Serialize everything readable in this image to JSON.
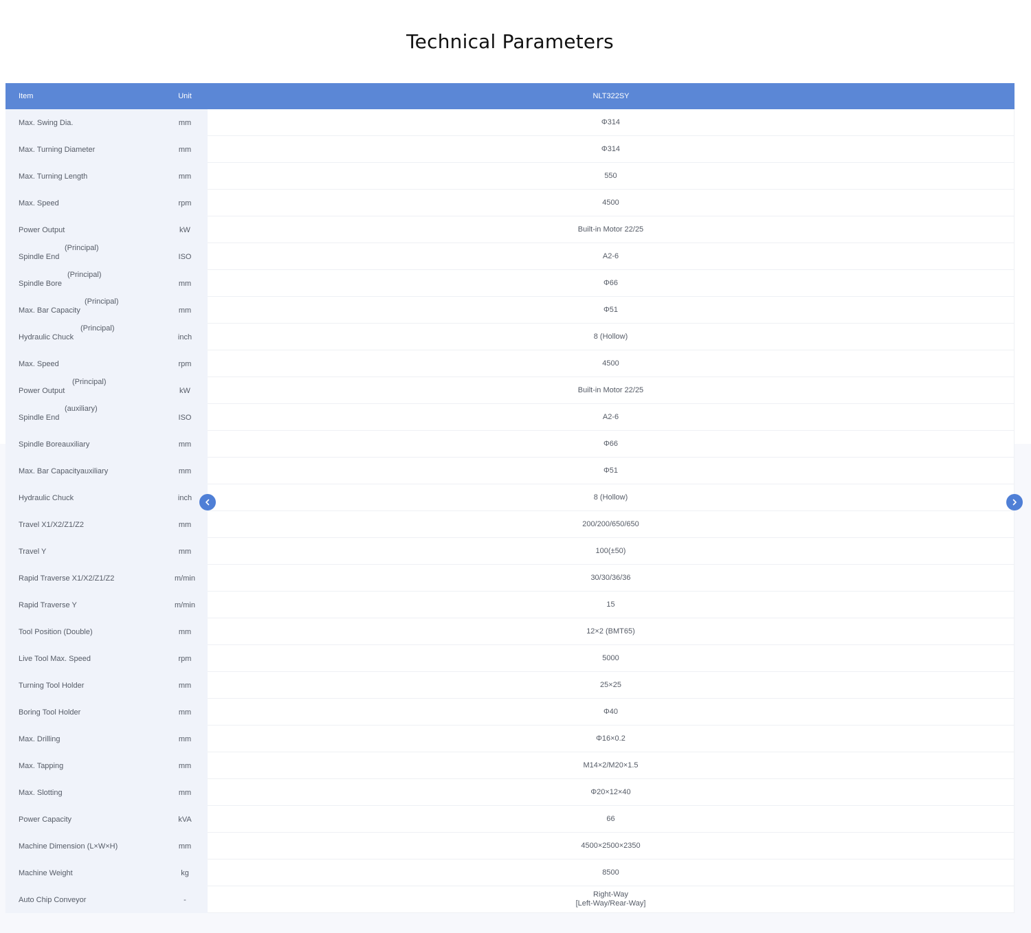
{
  "title": "Technical Parameters",
  "table": {
    "headers": {
      "item": "Item",
      "unit": "Unit",
      "model": "NLT322SY"
    },
    "rows": [
      {
        "item": "Max. Swing Dia.",
        "sub": "",
        "unit": "mm",
        "value": "Φ314"
      },
      {
        "item": "Max. Turning Diameter",
        "sub": "",
        "unit": "mm",
        "value": "Φ314"
      },
      {
        "item": "Max. Turning Length",
        "sub": "",
        "unit": "mm",
        "value": "550"
      },
      {
        "item": "Max. Speed",
        "sub": "",
        "unit": "rpm",
        "value": "4500"
      },
      {
        "item": "Power Output",
        "sub": "",
        "unit": "kW",
        "value": "Built-in   Motor 22/25"
      },
      {
        "item": "Spindle End",
        "sub": "(Principal)",
        "unit": "ISO",
        "value": "A2-6"
      },
      {
        "item": "Spindle Bore",
        "sub": "(Principal)",
        "unit": "mm",
        "value": "Φ66"
      },
      {
        "item": "Max. Bar Capacity",
        "sub": "(Principal)",
        "unit": "mm",
        "value": "Φ51"
      },
      {
        "item": "Hydraulic Chuck",
        "sub": "(Principal)",
        "unit": "inch",
        "value": "8   (Hollow)"
      },
      {
        "item": "Max. Speed",
        "sub": "",
        "unit": "rpm",
        "value": "4500"
      },
      {
        "item": "Power Output",
        "sub": "(Principal)",
        "unit": "kW",
        "value": "Built-in   Motor 22/25"
      },
      {
        "item": "Spindle End",
        "sub": "(auxiliary)",
        "unit": "ISO",
        "value": "A2-6"
      },
      {
        "item": "Spindle Boreauxiliary",
        "sub": "",
        "unit": "mm",
        "value": "Φ66"
      },
      {
        "item": "Max. Bar Capacityauxiliary",
        "sub": "",
        "unit": "mm",
        "value": "Φ51"
      },
      {
        "item": "Hydraulic Chuck",
        "sub": "",
        "unit": "inch",
        "value": "8   (Hollow)"
      },
      {
        "item": "Travel X1/X2/Z1/Z2",
        "sub": "",
        "unit": "mm",
        "value": "200/200/650/650"
      },
      {
        "item": "Travel Y",
        "sub": "",
        "unit": "mm",
        "value": "100(±50)"
      },
      {
        "item": "Rapid Traverse X1/X2/Z1/Z2",
        "sub": "",
        "unit": "m/min",
        "value": "30/30/36/36"
      },
      {
        "item": "Rapid Traverse Y",
        "sub": "",
        "unit": "m/min",
        "value": "15"
      },
      {
        "item": "Tool Position (Double)",
        "sub": "",
        "unit": "mm",
        "value": "12×2   (BMT65)"
      },
      {
        "item": "Live Tool Max. Speed",
        "sub": "",
        "unit": "rpm",
        "value": "5000"
      },
      {
        "item": "Turning Tool Holder",
        "sub": "",
        "unit": "mm",
        "value": "25×25"
      },
      {
        "item": "Boring Tool Holder",
        "sub": "",
        "unit": "mm",
        "value": "Φ40"
      },
      {
        "item": "Max. Drilling",
        "sub": "",
        "unit": "mm",
        "value": "Φ16×0.2"
      },
      {
        "item": "Max. Tapping",
        "sub": "",
        "unit": "mm",
        "value": "M14×2/M20×1.5"
      },
      {
        "item": "Max. Slotting",
        "sub": "",
        "unit": "mm",
        "value": "Φ20×12×40"
      },
      {
        "item": "Power Capacity",
        "sub": "",
        "unit": "kVA",
        "value": "66"
      },
      {
        "item": "Machine Dimension (L×W×H)",
        "sub": "",
        "unit": "mm",
        "value": "4500×2500×2350"
      },
      {
        "item": "Machine Weight",
        "sub": "",
        "unit": "kg",
        "value": "8500"
      },
      {
        "item": "Auto Chip Conveyor",
        "sub": "",
        "unit": "-",
        "value": "Right-Way\n[Left-Way/Rear-Way]"
      }
    ]
  },
  "nav": {
    "prev_icon": "chevron-left-icon",
    "next_icon": "chevron-right-icon",
    "accent": "#5b87d6"
  }
}
